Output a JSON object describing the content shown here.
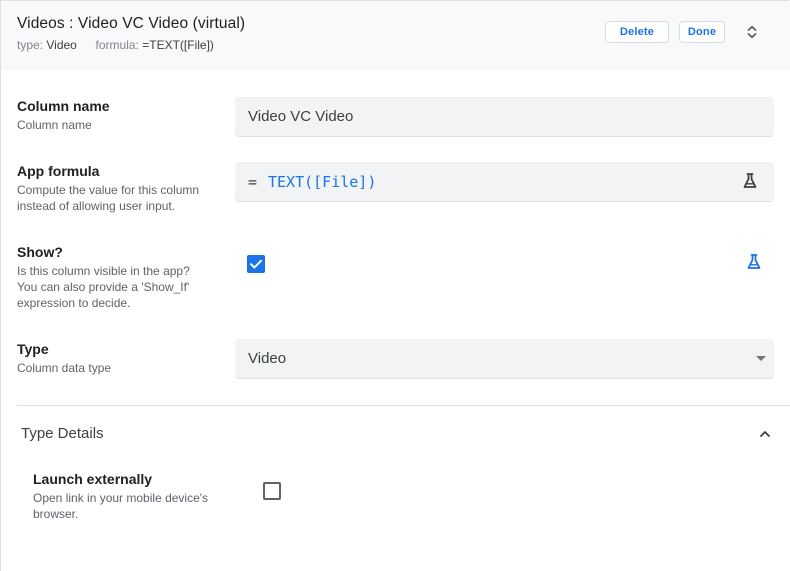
{
  "header": {
    "title": "Videos : Video VC Video (virtual)",
    "type_key": "type:",
    "type_value": "Video",
    "formula_key": "formula:",
    "formula_value": "=TEXT([File])",
    "delete_label": "Delete",
    "done_label": "Done",
    "expand_icon": "unfold-more-icon"
  },
  "fields": {
    "column_name": {
      "label": "Column name",
      "description": "Column name",
      "value": "Video VC Video"
    },
    "app_formula": {
      "label": "App formula",
      "description_line1": "Compute the value for this column",
      "description_line2": "instead of allowing user input.",
      "equals": "=",
      "value": "TEXT([File])",
      "icon": "flask-icon"
    },
    "show": {
      "label": "Show?",
      "description_line1": "Is this column visible in the app?",
      "description_line2": "You can also provide a 'Show_If'",
      "description_line3": "expression to decide.",
      "checked": true,
      "icon": "flask-icon"
    },
    "type": {
      "label": "Type",
      "description": "Column data type",
      "selected": "Video"
    }
  },
  "type_details": {
    "title": "Type Details",
    "expanded": true,
    "launch_externally": {
      "label": "Launch externally",
      "description_line1": "Open link in your mobile device's",
      "description_line2": "browser.",
      "checked": false
    }
  },
  "colors": {
    "accent": "#1a73e8",
    "field_background": "#f1f3f4",
    "header_background": "#f8f9fa"
  }
}
